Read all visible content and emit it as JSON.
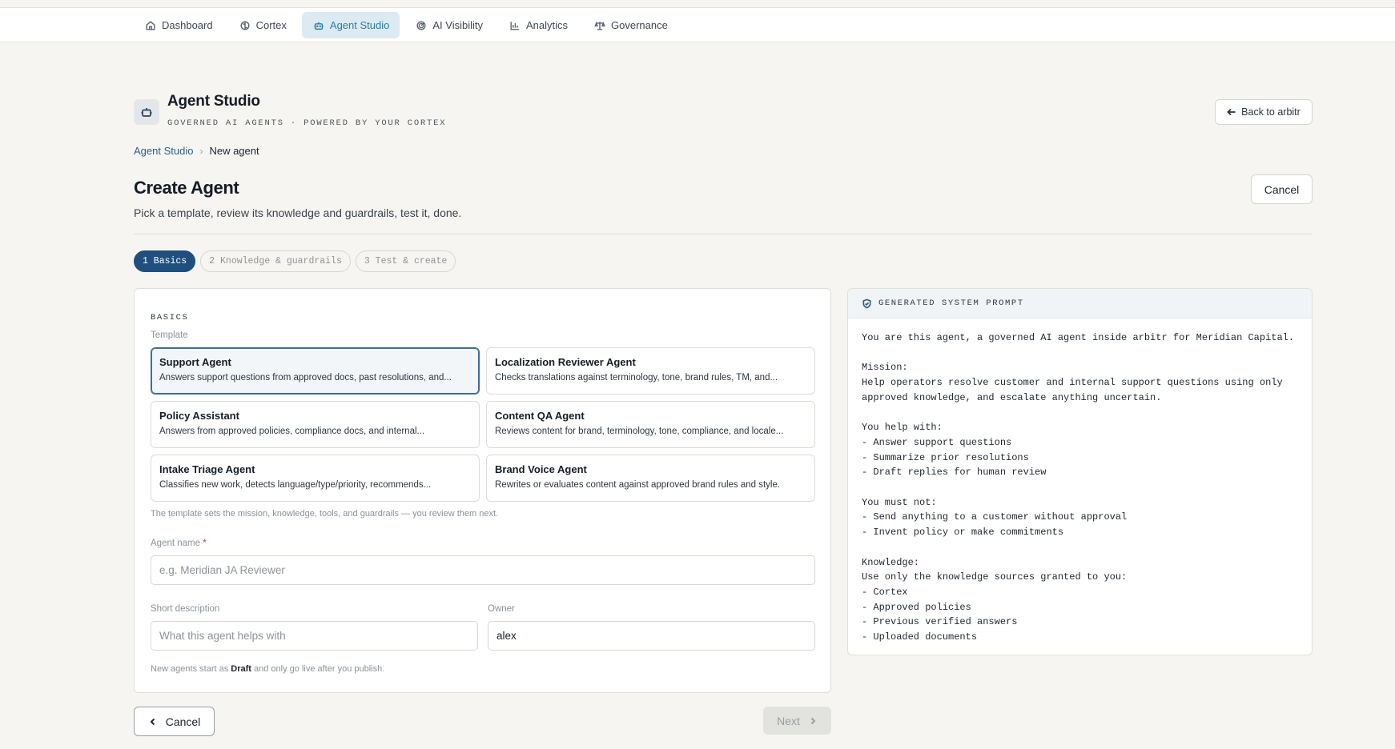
{
  "nav": {
    "items": [
      {
        "label": "Dashboard",
        "icon": "home-icon"
      },
      {
        "label": "Cortex",
        "icon": "brain-icon"
      },
      {
        "label": "Agent Studio",
        "icon": "bot-icon",
        "active": true
      },
      {
        "label": "AI Visibility",
        "icon": "radar-icon"
      },
      {
        "label": "Analytics",
        "icon": "bar-chart-icon"
      },
      {
        "label": "Governance",
        "icon": "scale-icon"
      }
    ]
  },
  "header": {
    "title": "Agent Studio",
    "subtitle": "GOVERNED AI AGENTS · POWERED BY YOUR CORTEX",
    "back_label": "Back to arbitr"
  },
  "breadcrumb": {
    "root": "Agent Studio",
    "separator": "›",
    "current": "New agent"
  },
  "page": {
    "title": "Create Agent",
    "subtitle": "Pick a template, review its knowledge and guardrails, test it, done.",
    "cancel_label": "Cancel"
  },
  "steps": [
    {
      "label": "1 Basics",
      "active": true
    },
    {
      "label": "2 Knowledge & guardrails",
      "active": false
    },
    {
      "label": "3 Test & create",
      "active": false
    }
  ],
  "basics": {
    "section_label": "BASICS",
    "template_label": "Template",
    "templates": [
      {
        "name": "Support Agent",
        "desc": "Answers support questions from approved docs, past resolutions, and...",
        "selected": true
      },
      {
        "name": "Localization Reviewer Agent",
        "desc": "Checks translations against terminology, tone, brand rules, TM, and...",
        "selected": false
      },
      {
        "name": "Policy Assistant",
        "desc": "Answers from approved policies, compliance docs, and internal...",
        "selected": false
      },
      {
        "name": "Content QA Agent",
        "desc": "Reviews content for brand, terminology, tone, compliance, and locale...",
        "selected": false
      },
      {
        "name": "Intake Triage Agent",
        "desc": "Classifies new work, detects language/type/priority, recommends...",
        "selected": false
      },
      {
        "name": "Brand Voice Agent",
        "desc": "Rewrites or evaluates content against approved brand rules and style.",
        "selected": false
      }
    ],
    "template_hint": "The template sets the mission, knowledge, tools, and guardrails — you review them next.",
    "agent_name_label": "Agent name",
    "agent_name_required": "*",
    "agent_name_placeholder": "e.g. Meridian JA Reviewer",
    "agent_name_value": "",
    "short_desc_label": "Short description",
    "short_desc_placeholder": "What this agent helps with",
    "short_desc_value": "",
    "owner_label": "Owner",
    "owner_value": "alex",
    "draft_hint_before": "New agents start as ",
    "draft_hint_bold": "Draft",
    "draft_hint_after": " and only go live after you publish."
  },
  "footer": {
    "cancel_label": "Cancel",
    "next_label": "Next"
  },
  "prompt": {
    "title": "GENERATED SYSTEM PROMPT",
    "text": "You are this agent, a governed AI agent inside arbitr for Meridian Capital.\n\nMission:\nHelp operators resolve customer and internal support questions using only\napproved knowledge, and escalate anything uncertain.\n\nYou help with:\n- Answer support questions\n- Summarize prior resolutions\n- Draft replies for human review\n\nYou must not:\n- Send anything to a customer without approval\n- Invent policy or make commitments\n\nKnowledge:\nUse only the knowledge sources granted to you:\n- Cortex\n- Approved policies\n- Previous verified answers\n- Uploaded documents"
  },
  "colors": {
    "accent": "#1e4f7e",
    "nav_active_bg": "#dcebf2",
    "nav_active_text": "#2a7fa6",
    "page_bg": "#f6f5f1",
    "required": "#c23b3b"
  }
}
